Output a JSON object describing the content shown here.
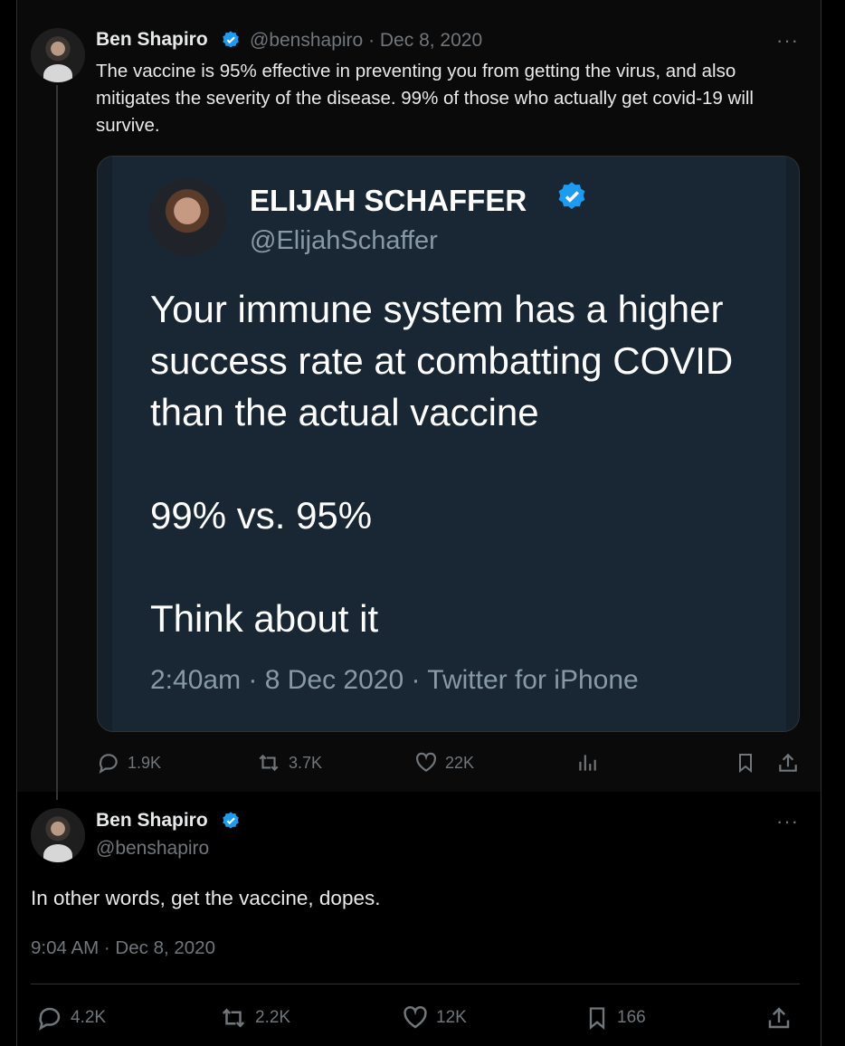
{
  "first_tweet": {
    "author": "Ben Shapiro",
    "handle_date": "@benshapiro · Dec 8, 2020",
    "text": "The vaccine is 95% effective in preventing you from getting the virus, and also mitigates the severity of the disease. 99% of those who actually get covid-19 will survive.",
    "more_label": "···",
    "actions": {
      "replies": "1.9K",
      "reposts": "3.7K",
      "likes": "22K"
    }
  },
  "quoted_tweet": {
    "author": "ELIJAH SCHAFFER",
    "handle": "@ElijahSchaffer",
    "lines": [
      "Your immune system has a higher success rate at combatting COVID than the actual vaccine",
      "99% vs. 95%",
      "Think about it"
    ],
    "meta": "2:40am · 8 Dec 2020 · Twitter for iPhone"
  },
  "main_tweet": {
    "author": "Ben Shapiro",
    "handle": "@benshapiro",
    "text": "In other words, get the vaccine, dopes.",
    "timestamp": "9:04 AM · Dec 8, 2020",
    "more_label": "···",
    "actions": {
      "replies": "4.2K",
      "reposts": "2.2K",
      "likes": "12K",
      "bookmarks": "166"
    }
  },
  "colors": {
    "background": "#000000",
    "text": "#e7e9ea",
    "muted": "#71767b",
    "verified": "#1d9bf0"
  },
  "icons": [
    "reply-icon",
    "repost-icon",
    "like-icon",
    "views-icon",
    "bookmark-icon",
    "share-icon",
    "verified-badge-icon",
    "more-icon"
  ]
}
